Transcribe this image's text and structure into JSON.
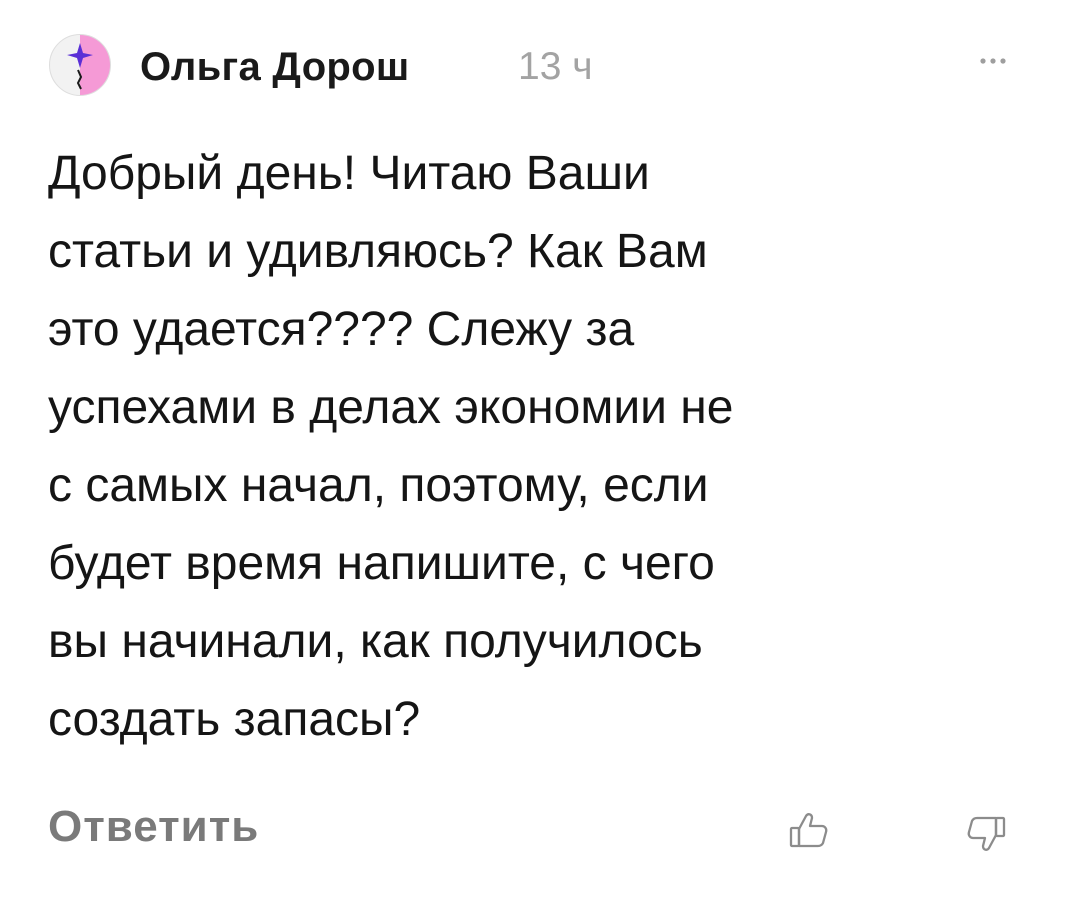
{
  "comment": {
    "author": "Ольга Дорош",
    "time": "13 ч",
    "text": "Добрый день! Читаю Ваши\nстатьи и удивляюсь? Как Вам\nэто удается???? Слежу за\nуспехами в делах экономии не\nс самых начал, поэтому, если\nбудет время напишите, с чего\nвы начинали, как получилось\nсоздать запасы?",
    "reply_label": "Ответить",
    "icons": {
      "avatar": "avatar-icon",
      "more": "more-options-icon",
      "like": "thumbs-up-icon",
      "dislike": "thumbs-down-icon"
    }
  },
  "colors": {
    "text": "#151515",
    "muted": "#a3a3a3",
    "reply": "#7a7a7a",
    "icon": "#8c8c8c",
    "avatar_pink": "#f59ad6",
    "avatar_purple": "#5a2fd6"
  }
}
